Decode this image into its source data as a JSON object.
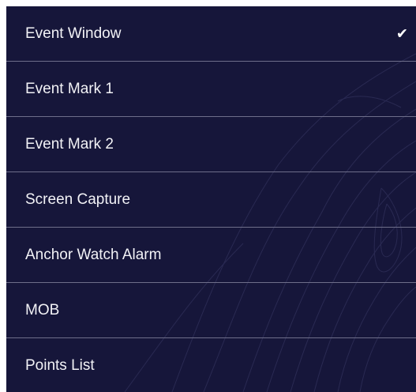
{
  "menu": {
    "items": [
      {
        "label": "Event Window",
        "checked": true,
        "check_icon": "checkmark-icon",
        "check_glyph": "✔"
      },
      {
        "label": "Event Mark 1",
        "checked": false
      },
      {
        "label": "Event Mark 2",
        "checked": false
      },
      {
        "label": "Screen Capture",
        "checked": false
      },
      {
        "label": "Anchor Watch Alarm",
        "checked": false
      },
      {
        "label": "MOB",
        "checked": false
      },
      {
        "label": "Points List",
        "checked": false
      }
    ]
  },
  "colors": {
    "background": "#16163a",
    "divider": "#6e6e8a",
    "text": "#f2f2f6",
    "contour": "#3a3a66"
  }
}
